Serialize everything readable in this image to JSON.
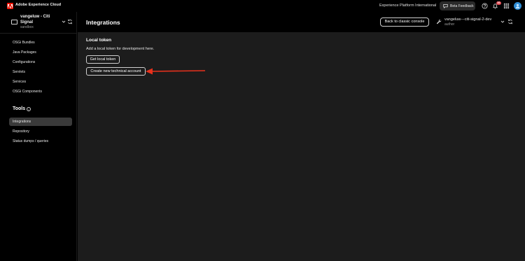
{
  "topbar": {
    "app_title": "Adobe Experience Cloud",
    "org_name": "Experience Platform International",
    "beta_feedback_label": "Beta Feedback",
    "notification_count": "10"
  },
  "sidebar": {
    "context_name": "vangeluw - Citi Signal",
    "context_sub": "sandbox",
    "items": [
      {
        "label": "OSGi Bundles"
      },
      {
        "label": "Java Packages"
      },
      {
        "label": "Configurations"
      },
      {
        "label": "Servlets"
      },
      {
        "label": "Services"
      },
      {
        "label": "OSGi Components"
      }
    ],
    "tools_heading": "Tools",
    "tools_items": [
      {
        "label": "Integrations",
        "active": true
      },
      {
        "label": "Repository"
      },
      {
        "label": "Status dumps / queries"
      }
    ]
  },
  "main": {
    "title": "Integrations",
    "back_button_label": "Back to classic console",
    "environment_name": "vangeluw---citi-signal-2-dev",
    "environment_role": "author",
    "section_title": "Local token",
    "section_description": "Add a local token for development here.",
    "get_token_label": "Get local token",
    "create_account_label": "Create new technical account"
  },
  "colors": {
    "brand_red": "#eb1000",
    "annotation_arrow": "#e8311c",
    "content_bg": "#1c1c1c",
    "active_nav_bg": "#3a3a3a"
  }
}
